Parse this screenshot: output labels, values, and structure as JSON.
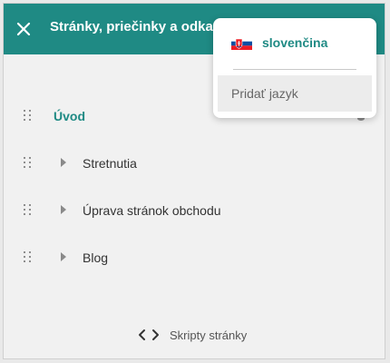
{
  "header": {
    "title": "Stránky, priečinky a odkazy",
    "close_icon": "close-icon",
    "background_color": "#1f8a84"
  },
  "pages": {
    "items": [
      {
        "label": "Úvod",
        "type": "home",
        "expandable": false,
        "active": true
      },
      {
        "label": "Stretnutia",
        "type": "child",
        "expandable": true,
        "active": false
      },
      {
        "label": "Úprava stránok obchodu",
        "type": "child",
        "expandable": true,
        "active": false
      },
      {
        "label": "Blog",
        "type": "child",
        "expandable": true,
        "active": false
      }
    ],
    "drag_icon": "drag-handle-icon",
    "expand_icon": "caret-right-icon"
  },
  "footer": {
    "scripts_label": "Skripty stránky",
    "scripts_icon": "code-brackets-icon"
  },
  "language_menu": {
    "current_language": "slovenčina",
    "flag_icon": "slovak-flag-icon",
    "add_language_label": "Pridať jazyk",
    "accent_color": "#1f8a84"
  }
}
